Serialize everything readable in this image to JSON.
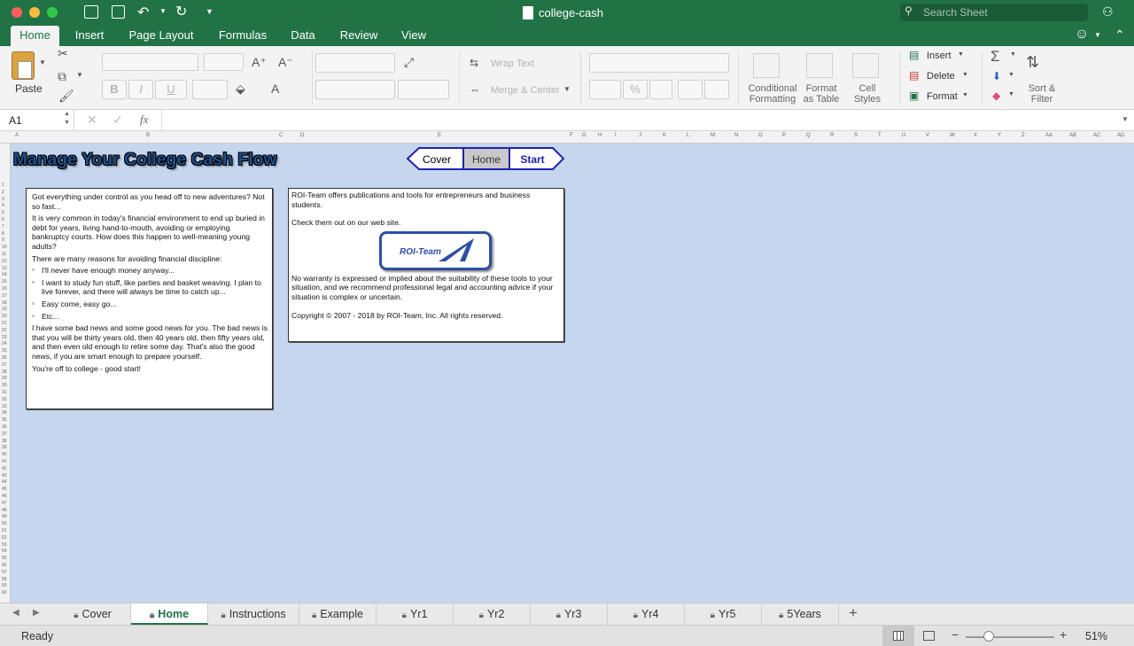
{
  "window": {
    "title": "college-cash",
    "search_placeholder": "Search Sheet"
  },
  "ribbon_tabs": [
    "Home",
    "Insert",
    "Page Layout",
    "Formulas",
    "Data",
    "Review",
    "View"
  ],
  "ribbon": {
    "paste": "Paste",
    "bold": "B",
    "italic": "I",
    "underline": "U",
    "wrap_text": "Wrap Text",
    "merge_center": "Merge & Center",
    "percent": "%",
    "conditional_formatting_1": "Conditional",
    "conditional_formatting_2": "Formatting",
    "format_table_1": "Format",
    "format_table_2": "as Table",
    "cell_styles_1": "Cell",
    "cell_styles_2": "Styles",
    "insert": "Insert",
    "delete": "Delete",
    "format": "Format",
    "sort_filter_1": "Sort &",
    "sort_filter_2": "Filter"
  },
  "formula_bar": {
    "name_box": "A1",
    "fx": "fx",
    "value": ""
  },
  "columns": [
    "A",
    "B",
    "C",
    "D",
    "E",
    "F",
    "G",
    "H",
    "I",
    "J",
    "K",
    "L",
    "M",
    "N",
    "O",
    "P",
    "Q",
    "R",
    "S",
    "T",
    "U",
    "V",
    "W",
    "X",
    "Y",
    "Z",
    "AA",
    "AB",
    "AC",
    "AD"
  ],
  "sheet": {
    "title": "Manage Your College Cash Flow",
    "nav": {
      "cover": "Cover",
      "home": "Home",
      "start": "Start"
    },
    "left": {
      "p1": "Got everything under control as you head off to new adventures? Not so fast...",
      "p2": "It is very common in today's financial environment to end up buried in debt for years, living hand-to-mouth, avoiding or employing bankruptcy courts. How does this happen to well-meaning young adults?",
      "p3": "There are many reasons for avoiding financial discipline:",
      "bullets": [
        "I'll never have enough money anyway...",
        "I want to study fun stuff, like parties and basket weaving. I plan to live forever, and there will always be time to catch up...",
        "Easy come, easy go...",
        "Etc..."
      ],
      "p4": "I have some bad news and some good news for you. The bad news is that you will be thirty years old, then 40 years old, then fifty years old, and then even old enough to retire some day. That's also the good news, if you are smart enough to prepare yourself.",
      "p5": "You're off to college - good start!"
    },
    "right": {
      "p1": "ROI-Team offers publications and tools for entrepreneurs and business students.",
      "p2": "Check them out on our web site.",
      "logo_text": "ROI-Team",
      "p3": "No warranty is expressed or implied about the suitability of these tools to your situation, and we recommend professional legal and accounting advice if your situation is complex or uncertain.",
      "p4": "Copyright © 2007 - 2018 by ROI-Team, Inc.  All rights reserved."
    }
  },
  "sheet_tabs": [
    "Cover",
    "Home",
    "Instructions",
    "Example",
    "Yr1",
    "Yr2",
    "Yr3",
    "Yr4",
    "Yr5",
    "5Years"
  ],
  "status": {
    "text": "Ready",
    "zoom": "51%",
    "minus": "−",
    "plus": "+"
  },
  "colors": {
    "excel_green": "#217346",
    "sheet_bg": "#c5d6ee",
    "title_blue": "#1f4e8c"
  }
}
